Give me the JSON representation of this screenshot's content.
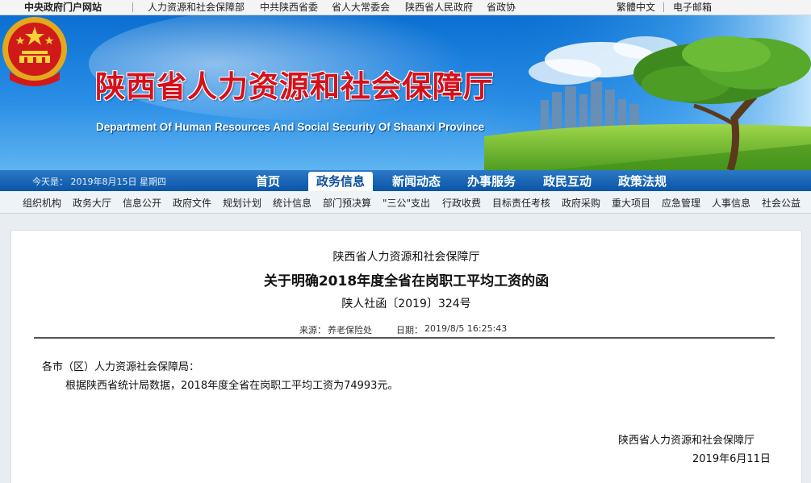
{
  "top_links": {
    "portal": "中央政府门户网站",
    "links": [
      "人力资源和社会保障部",
      "中共陕西省委",
      "省人大常委会",
      "陕西省人民政府",
      "省政协"
    ],
    "traditional": "繁體中文",
    "email": "电子邮箱"
  },
  "header": {
    "title_cn": "陕西省人力资源和社会保障厅",
    "title_en": "Department Of Human Resources And Social Security Of Shaanxi Province"
  },
  "nav": {
    "today": "今天是：  2019年8月15日  星期四",
    "items": [
      "首页",
      "政务信息",
      "新闻动态",
      "办事服务",
      "政民互动",
      "政策法规"
    ],
    "active_index": 1
  },
  "subnav": {
    "items": [
      "组织机构",
      "政务大厅",
      "信息公开",
      "政府文件",
      "规划计划",
      "统计信息",
      "部门预决算",
      "\"三公\"支出",
      "行政收费",
      "目标责任考核",
      "政府采购",
      "重大项目",
      "应急管理",
      "人事信息",
      "社会公益"
    ]
  },
  "doc": {
    "org": "陕西省人力资源和社会保障厅",
    "title": "关于明确2018年度全省在岗职工平均工资的函",
    "number": "陕人社函〔2019〕324号",
    "source_label": "来源：",
    "source": "养老保险处",
    "date_label": "日期：",
    "date": "2019/8/5 16:25:43",
    "salutation": "各市（区）人力资源社会保障局：",
    "body": "根据陕西省统计局数据，2018年度全省在岗职工平均工资为74993元。",
    "signature": "陕西省人力资源和社会保障厅",
    "sign_date": "2019年6月11日"
  },
  "colors": {
    "title_red": "#d6101b",
    "nav_blue": "#0b55a6",
    "banner_blue": "#0a6fd1"
  }
}
